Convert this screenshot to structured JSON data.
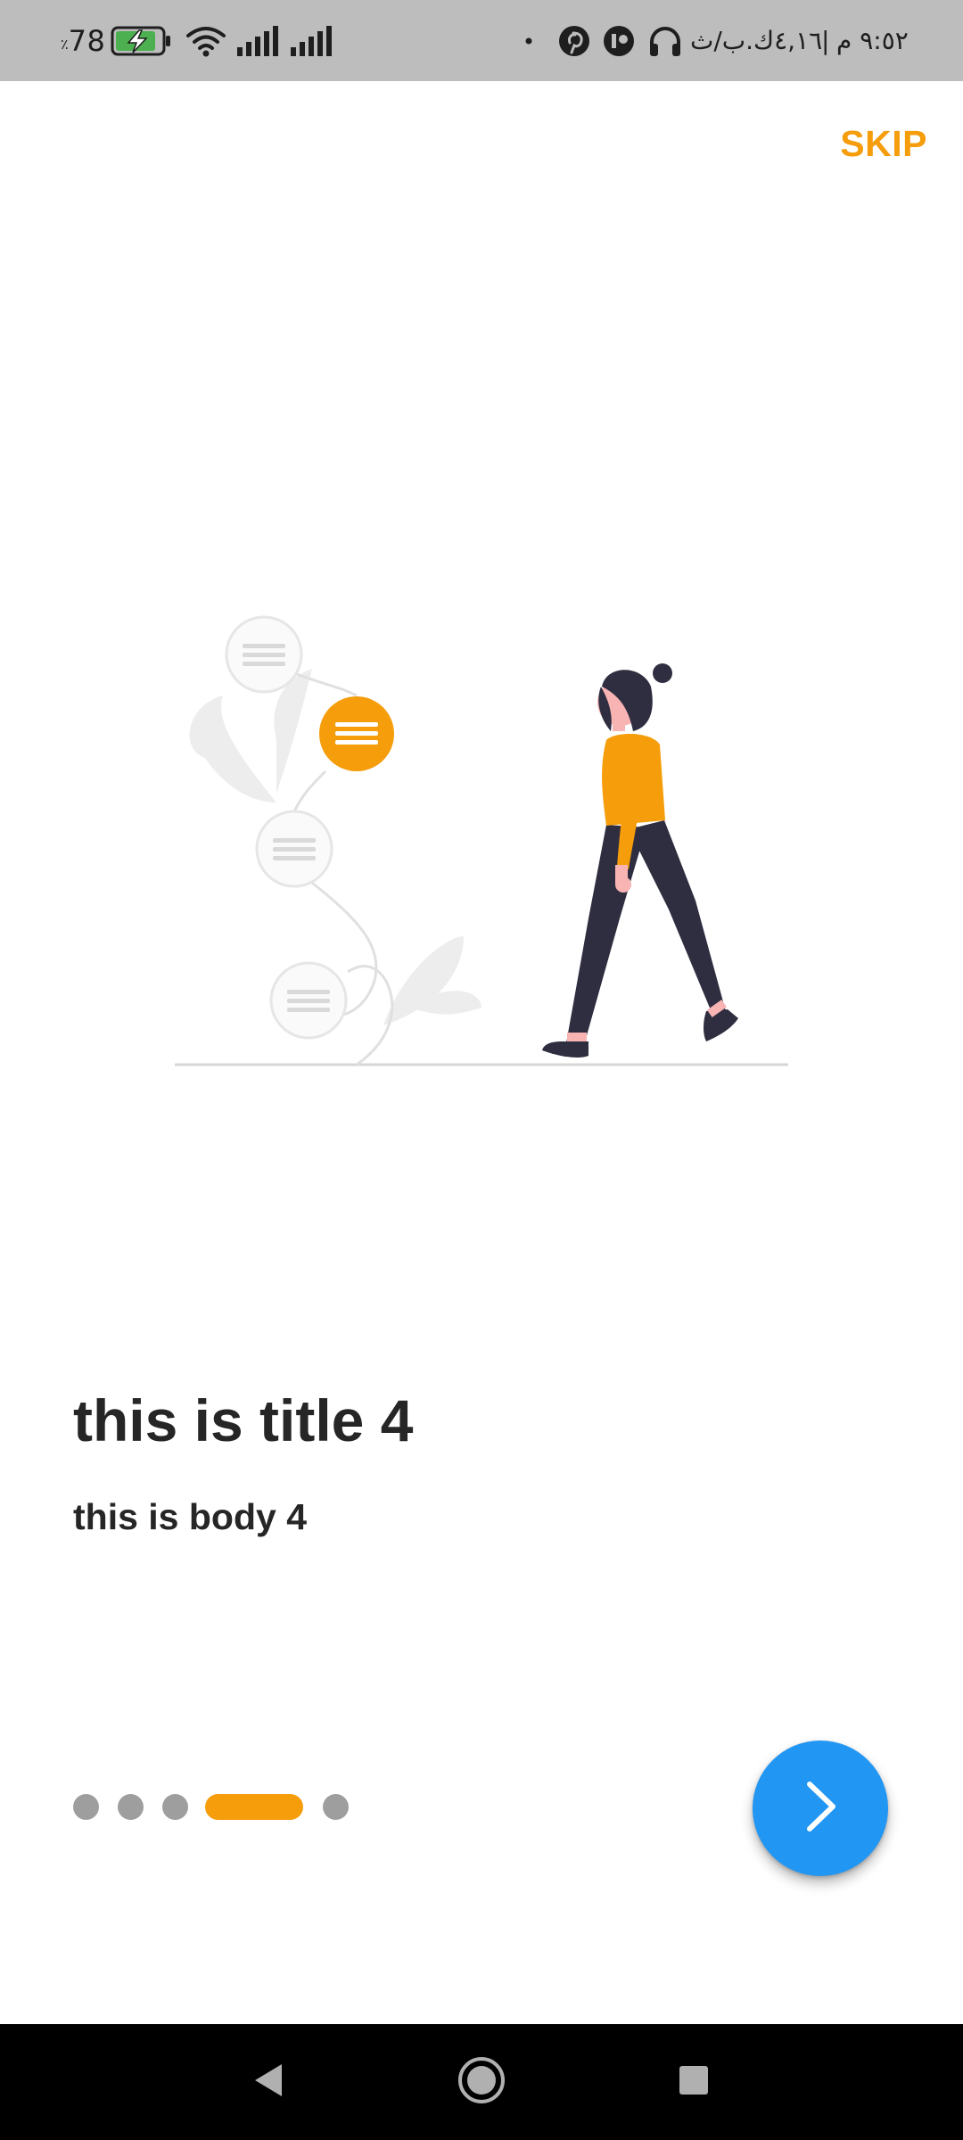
{
  "status_bar": {
    "battery_percent": "78",
    "percent_sign": "٪",
    "carrier_text": "٤,١٦ك.ب/ث",
    "separator": "|",
    "clock": "٩:٥٢ م",
    "icons": [
      "battery-charging-icon",
      "wifi-icon",
      "signal-icon",
      "signal-icon",
      "dot-icon",
      "pinterest-icon",
      "app-icon",
      "headphones-icon"
    ]
  },
  "header": {
    "skip_label": "SKIP"
  },
  "page": {
    "title": "this is title 4",
    "body": "this is body 4"
  },
  "pager": {
    "total": 5,
    "active_index": 3
  },
  "fab": {
    "icon": "chevron-right-icon"
  },
  "navigation_bar": {
    "icons": [
      "back-icon",
      "home-icon",
      "recents-icon"
    ]
  },
  "colors": {
    "accent": "#f59d0b",
    "fab": "#2196f3",
    "text": "#262626",
    "dot_inactive": "#9e9e9e",
    "status_bar": "#bdbdbd",
    "nav_bar": "#000000"
  }
}
